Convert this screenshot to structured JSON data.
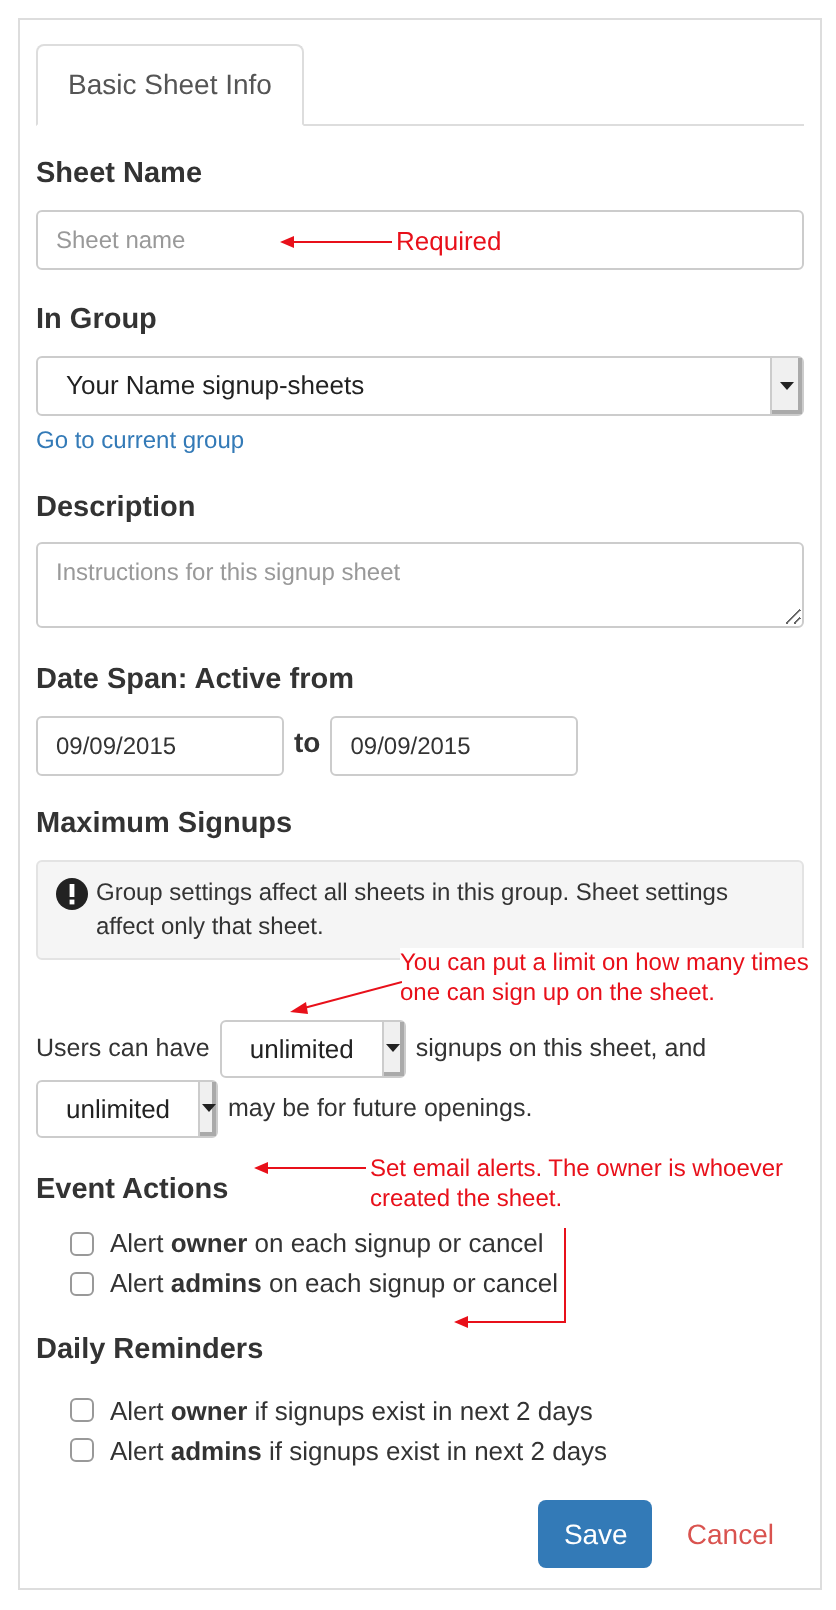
{
  "tabs": [
    {
      "label": "Basic Sheet Info",
      "selected": true
    }
  ],
  "sheet_name": {
    "label": "Sheet Name",
    "placeholder": "Sheet name"
  },
  "in_group": {
    "label": "In Group",
    "value": "Your Name signup-sheets",
    "link": "Go to current group"
  },
  "description": {
    "label": "Description",
    "placeholder": "Instructions for this signup sheet"
  },
  "date_span": {
    "label": "Date Span: Active from",
    "from": "09/09/2015",
    "separator": "to",
    "to": "09/09/2015"
  },
  "maximum_signups": {
    "label": "Maximum Signups",
    "notice": "Group settings affect all sheets in this group. Sheet settings affect only that sheet.",
    "prefix": "Users can have",
    "select_1": "unlimited",
    "middle": "signups on this sheet, and",
    "select_2": "unlimited",
    "suffix": "may be for future openings."
  },
  "event_actions": {
    "label": "Event Actions",
    "options": [
      {
        "text": "Alert **owner** on each signup or cancel",
        "checked": false
      },
      {
        "text": "Alert **admins** on each signup or cancel",
        "checked": false
      }
    ]
  },
  "daily_reminders": {
    "label": "Daily Reminders",
    "options": [
      {
        "text": "Alert **owner** if signups exist in next 2 days",
        "checked": false
      },
      {
        "text": "Alert **admins** if signups exist in next 2 days",
        "checked": false
      }
    ]
  },
  "buttons": {
    "save": "Save",
    "cancel": "Cancel"
  },
  "annotations": [
    {
      "kind": "straight",
      "text": "Required"
    },
    {
      "kind": "slant",
      "text": "You can put a limit on how  many times one can sign up on the sheet."
    },
    {
      "kind": "straight",
      "text": "Set email alerts. The owner is whoever created the sheet."
    },
    {
      "kind": "elbow"
    }
  ]
}
